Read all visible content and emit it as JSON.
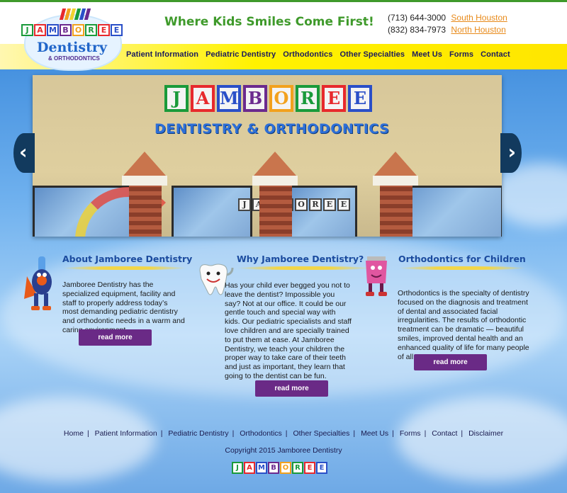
{
  "header": {
    "logo": {
      "word_letters": [
        "J",
        "A",
        "M",
        "B",
        "O",
        "R",
        "E",
        "E"
      ],
      "script": "Dentistry",
      "sub": "& ORTHODONTICS",
      "block_colors": [
        "#1a9a3a",
        "#e7292c",
        "#2a4fc8",
        "#6b2a8e",
        "#f2a11d",
        "#1a9a3a",
        "#e7292c",
        "#2a4fc8"
      ],
      "stripe_colors": [
        "#e7292c",
        "#f2a11d",
        "#f2d22e",
        "#1a9a3a",
        "#2a4fc8",
        "#6b2a8e"
      ]
    },
    "tagline": "Where Kids Smiles Come First!",
    "phones": [
      {
        "number": "(713) 644-3000",
        "location": "South Houston"
      },
      {
        "number": "(832) 834-7973",
        "location": "North Houston"
      }
    ],
    "nav": [
      "Patient Information",
      "Pediatric Dentistry",
      "Orthodontics",
      "Other Specialties",
      "Meet Us",
      "Forms",
      "Contact"
    ]
  },
  "slider": {
    "sign_letters": [
      "J",
      "A",
      "M",
      "B",
      "O",
      "R",
      "E",
      "E"
    ],
    "sign_colors": [
      "#1a9a3a",
      "#e7292c",
      "#2a4fc8",
      "#6b2a8e",
      "#f2a11d",
      "#1a9a3a",
      "#e7292c",
      "#2a4fc8"
    ],
    "sign_subtitle": "DENTISTRY & ORTHODONTICS",
    "door_letters": [
      "J",
      "A",
      "M",
      "B",
      "O",
      "R",
      "E",
      "E"
    ],
    "prev_icon": "‹",
    "next_icon": "›"
  },
  "columns": [
    {
      "title": "About Jamboree Dentistry",
      "body": "Jamboree Dentistry has the specialized equipment, facility and staff to properly address today’s most demanding pediatric dentistry and orthodontic needs in a warm and caring environment.",
      "button": "read more",
      "mascot": "superhero-toothbrush-icon"
    },
    {
      "title": "Why Jamboree Dentistry?",
      "body": "Has your child ever begged you not to leave the dentist? Impossible you say? Not at our office. It could be our gentle touch and special way with kids. Our pediatric specialists and staff love children and are specially trained to put them at ease. At Jamboree Dentistry, we teach your children the proper way to take care of their teeth and just as important, they learn that going to the dentist can be fun.",
      "button": "read more",
      "mascot": "smiling-tooth-icon"
    },
    {
      "title": "Orthodontics for Children",
      "body": "Orthodontics is the specialty of dentistry focused on the diagnosis and treatment of dental and associated facial irregularities. The results of orthodontic treatment can be dramatic — beautiful smiles, improved dental health and an enhanced quality of life for many people of all ages.",
      "button": "read more",
      "mascot": "pink-toothpaste-icon"
    }
  ],
  "footer": {
    "links": [
      "Home",
      "Patient Information",
      "Pediatric Dentistry",
      "Orthodontics",
      "Other Specialties",
      "Meet Us",
      "Forms",
      "Contact",
      "Disclaimer"
    ],
    "copyright": "Copyright 2015 Jamboree Dentistry",
    "logo_letters": [
      "J",
      "A",
      "M",
      "B",
      "O",
      "R",
      "E",
      "E"
    ]
  },
  "colors": {
    "accent_green": "#3f9a2b",
    "nav_yellow": "#fff200",
    "link_orange": "#e88a1a",
    "heading_blue": "#1a4a9e",
    "button_purple": "#6a2a86"
  }
}
